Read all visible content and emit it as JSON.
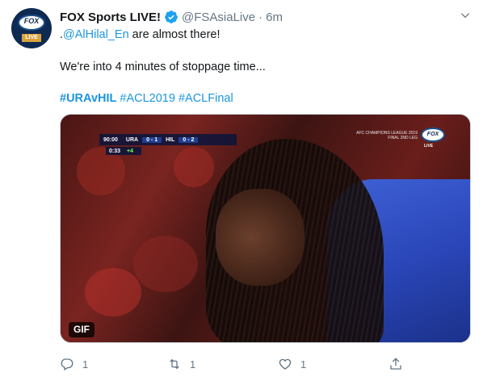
{
  "tweet": {
    "display_name": "FOX Sports LIVE!",
    "handle": "@FSAsiaLive",
    "separator": "·",
    "time": "6m",
    "avatar": {
      "logo_text": "FOX",
      "live_text": "LIVE"
    },
    "text": {
      "line1_prefix": ".",
      "mention": "@AlHilal_En",
      "line1_suffix": " are almost there!",
      "line2": "We're into 4 minutes of stoppage time...",
      "hashtags": [
        "#URAvHIL",
        "#ACL2019",
        "#ACLFinal"
      ]
    },
    "media": {
      "type_badge": "GIF",
      "scorebug": {
        "clock": "90:00",
        "home": "URA",
        "score": "0 - 1",
        "away": "HIL",
        "aggregate": "0 - 2",
        "stoppage_elapsed": "0:33",
        "added_time": "+4"
      },
      "competition_title": "AFC CHAMPIONS LEAGUE 2019 FINAL 2ND LEG",
      "broadcaster_logo": "FOX",
      "broadcaster_live": "LIVE"
    },
    "actions": {
      "reply_count": "1",
      "retweet_count": "1",
      "like_count": "1"
    }
  },
  "colors": {
    "link": "#1b95e0",
    "secondary_text": "#657786",
    "primary_text": "#14171a"
  }
}
